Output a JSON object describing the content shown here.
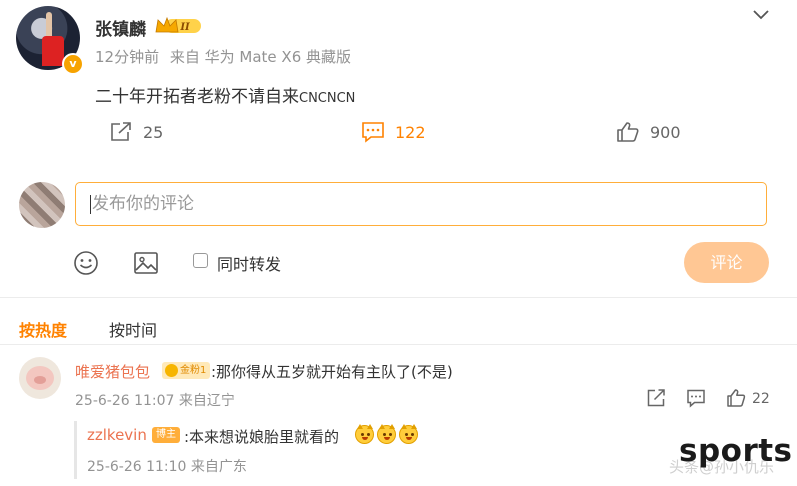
{
  "post": {
    "author": "张镇麟",
    "member_badge": "II",
    "time": "12分钟前",
    "source": "来自 华为 Mate X6 典藏版",
    "text": "二十年开拓者老粉不请自来",
    "text_tail": "CNCNCN",
    "reposts": "25",
    "comments": "122",
    "likes": "900"
  },
  "composer": {
    "placeholder": "发布你的评论",
    "repost_checkbox_label": "同时转发",
    "submit_label": "评论"
  },
  "sort_tabs": {
    "hot": "按热度",
    "time": "按时间"
  },
  "comments": [
    {
      "user": "唯爱猪包包",
      "fan_badge": "金粉1",
      "text": ":那你得从五岁就开始有主队了(不是)",
      "meta": "25-6-26 11:07 来自辽宁",
      "likes": "22",
      "replies": [
        {
          "user": "zzlkevin",
          "badge": "博主",
          "text": ":本来想说娘胎里就看的",
          "meta": "25-6-26 11:10 来自广东"
        }
      ]
    }
  ],
  "watermark": {
    "big": "sports",
    "small": "头条@孙小仇乐"
  },
  "colors": {
    "accent": "#ff8200",
    "input_border": "#ffae3a",
    "submit_disabled": "#ffc794",
    "username": "#eb7350"
  },
  "icons": [
    "crown-icon",
    "verified-icon",
    "chevron-down-icon",
    "repost-icon",
    "comment-icon",
    "like-icon",
    "emoji-icon",
    "image-icon"
  ]
}
